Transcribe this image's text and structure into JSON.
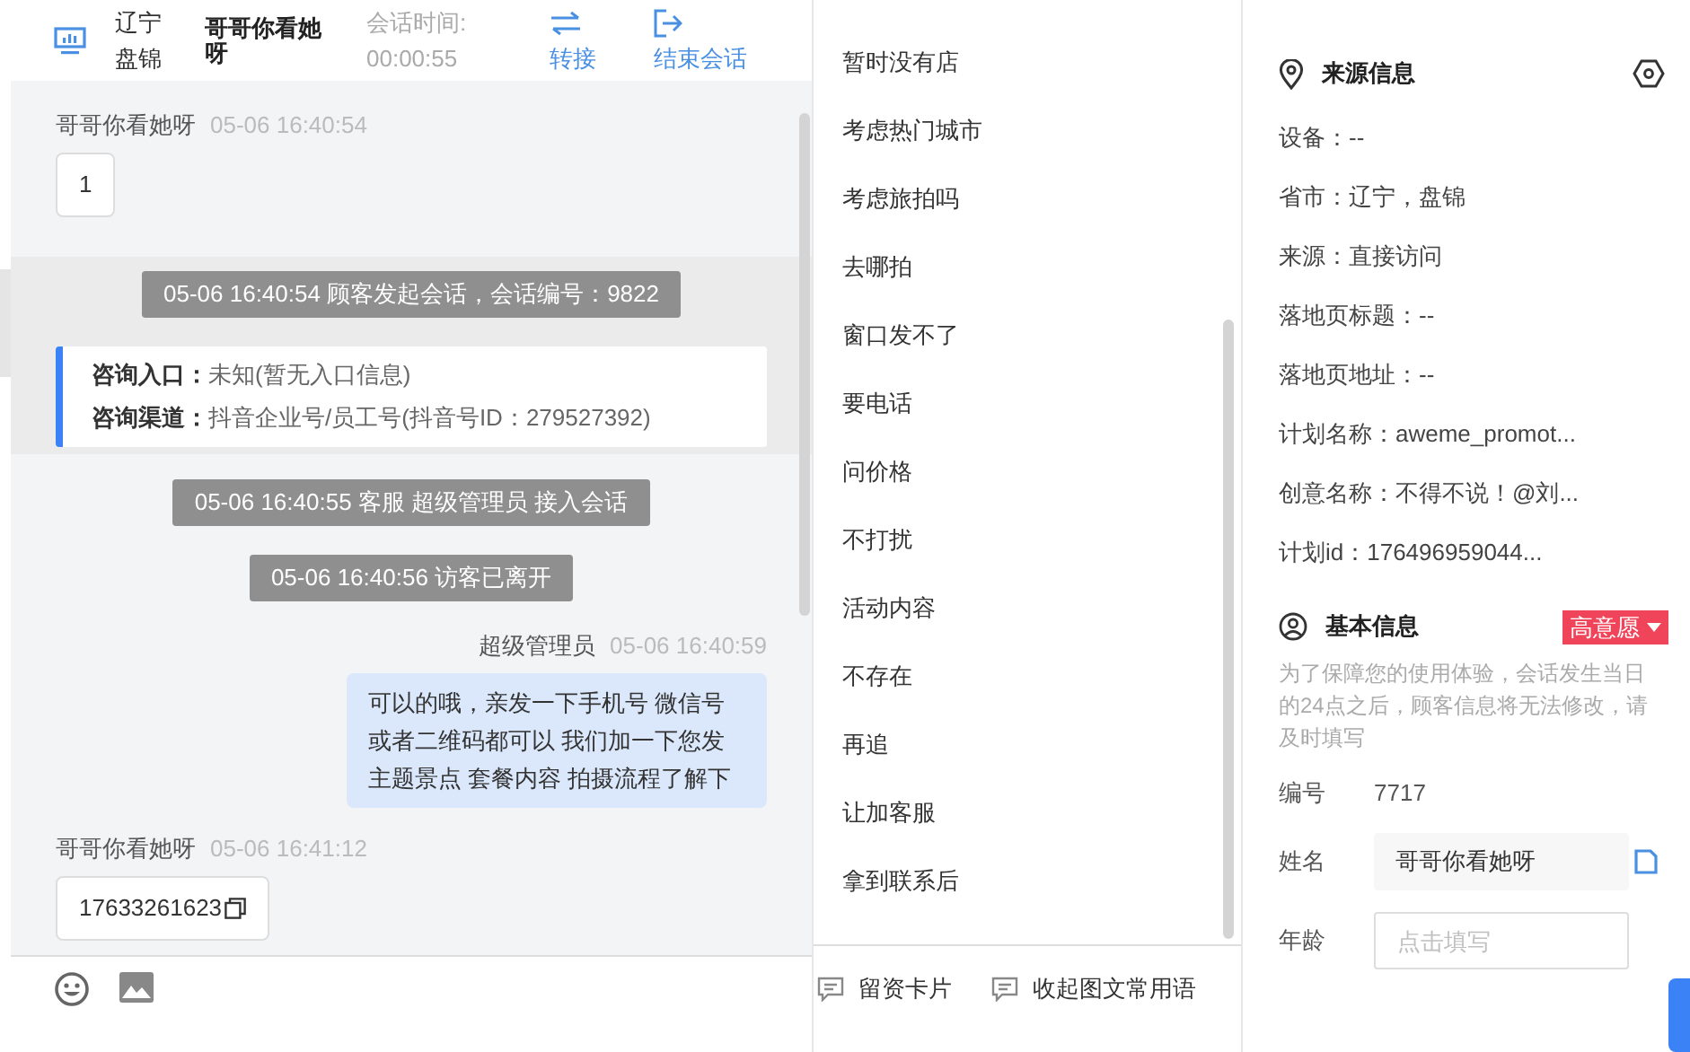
{
  "chat_header": {
    "location": "辽宁盘锦",
    "visitor": "哥哥你看她呀",
    "duration_label": "会话时间:",
    "duration": "00:00:55",
    "actions": [
      {
        "kind": "transfer",
        "label": "转接"
      },
      {
        "kind": "end",
        "label": "结束会话"
      }
    ]
  },
  "messages": [
    {
      "kind": "visitor",
      "sender": "哥哥你看她呀",
      "time": "05-06 16:40:54",
      "text": "1",
      "copyable": false
    },
    {
      "kind": "system",
      "text": "05-06 16:40:54 顾客发起会话，会话编号：9822",
      "highlighted": true
    },
    {
      "kind": "info",
      "highlighted": true,
      "rows": [
        {
          "label": "咨询入口：",
          "value": "未知(暂无入口信息)"
        },
        {
          "label": "咨询渠道：",
          "value": "抖音企业号/员工号(抖音号ID：279527392)"
        }
      ]
    },
    {
      "kind": "system",
      "text": "05-06 16:40:55 客服 超级管理员 接入会话",
      "highlighted": false
    },
    {
      "kind": "system",
      "text": "05-06 16:40:56 访客已离开",
      "highlighted": false
    },
    {
      "kind": "agent",
      "sender": "超级管理员",
      "time": "05-06 16:40:59",
      "text": "可以的哦，亲发一下手机号 微信号或者二维码都可以 我们加一下您发主题景点 套餐内容 拍摄流程了解下"
    },
    {
      "kind": "visitor",
      "sender": "哥哥你看她呀",
      "time": "05-06 16:41:12",
      "text": "17633261623",
      "copyable": true
    }
  ],
  "phrases": [
    "暂时没有店",
    "考虑热门城市",
    "考虑旅拍吗",
    "去哪拍",
    "窗口发不了",
    "要电话",
    "问价格",
    "不打扰",
    "活动内容",
    "不存在",
    "再追",
    "让加客服",
    "拿到联系后"
  ],
  "phrase_actions": [
    "留资卡片",
    "收起图文常用语"
  ],
  "source_info": {
    "title": "来源信息",
    "rows": [
      "设备：--",
      "省市：辽宁，盘锦",
      "来源：直接访问",
      "落地页标题：--",
      "落地页地址：--",
      "计划名称：aweme_promot...",
      "创意名称：不得不说！@刘...",
      "计划id：176496959044..."
    ]
  },
  "basic_info": {
    "title": "基本信息",
    "intent_tag": "高意愿",
    "notice": "为了保障您的使用体验，会话发生当日的24点之后，顾客信息将无法修改，请及时填写",
    "fields": [
      {
        "kind": "text",
        "label": "编号",
        "value": "7717"
      },
      {
        "kind": "filled",
        "label": "姓名",
        "value": "哥哥你看她呀"
      },
      {
        "kind": "input",
        "label": "年龄",
        "placeholder": "点击填写"
      }
    ]
  }
}
